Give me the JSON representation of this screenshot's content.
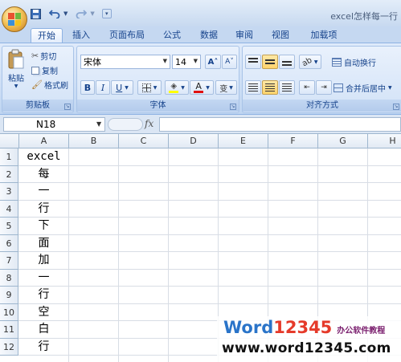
{
  "window": {
    "title": "excel怎样每一行"
  },
  "tabs": [
    "开始",
    "插入",
    "页面布局",
    "公式",
    "数据",
    "审阅",
    "视图",
    "加载项"
  ],
  "clipboard": {
    "label": "剪贴板",
    "paste": "粘贴",
    "cut": "剪切",
    "copy": "复制",
    "format_painter": "格式刷"
  },
  "font": {
    "label": "字体",
    "name": "宋体",
    "size": "14",
    "grow": "A˄",
    "shrink": "A˅",
    "bold": "B",
    "italic": "I",
    "underline": "U",
    "font_color": "A",
    "phonetic": "变"
  },
  "alignment": {
    "label": "对齐方式",
    "wrap_text": "自动换行",
    "merge_center": "合并后居中"
  },
  "formula_bar": {
    "name_box": "N18",
    "fx": "fx",
    "formula": ""
  },
  "sheet": {
    "columns": [
      "A",
      "B",
      "C",
      "D",
      "E",
      "F",
      "G",
      "H"
    ],
    "rows": [
      "1",
      "2",
      "3",
      "4",
      "5",
      "6",
      "7",
      "8",
      "9",
      "10",
      "11",
      "12"
    ],
    "column_a": [
      "excel",
      "每",
      "一",
      "行",
      "下",
      "面",
      "加",
      "一",
      "行",
      "空",
      "白",
      "行"
    ]
  },
  "watermark": {
    "word": "Word",
    "number": "12345",
    "subtitle": "办公软件教程",
    "url": "www.word12345.com"
  },
  "colors": {
    "ribbon_text": "#15428b",
    "watermark_blue": "#2a74c9",
    "watermark_red": "#e53a2a",
    "watermark_purple": "#7a1e6e"
  }
}
